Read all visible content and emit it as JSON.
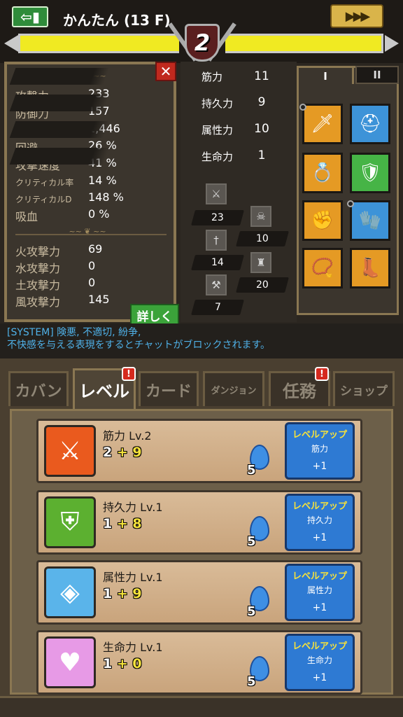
{
  "header": {
    "exit_icon": "exit-door-icon",
    "title": "かんたん (13 F)",
    "speed_label": "▶▶▶",
    "level": "2"
  },
  "stats": {
    "close_label": "✕",
    "rows": [
      {
        "label": "攻撃力",
        "value": "233"
      },
      {
        "label": "防御力",
        "value": "157"
      },
      {
        "label": "体力",
        "value": "1,446"
      },
      {
        "label": "回避",
        "value": "26 %"
      },
      {
        "label": "攻撃速度",
        "value": "41 %"
      },
      {
        "label": "クリティカル率",
        "value": "14 %"
      },
      {
        "label": "クリティカルD",
        "value": "148 %"
      },
      {
        "label": "吸血",
        "value": "0 %"
      }
    ],
    "element_rows": [
      {
        "label": "火攻撃力",
        "value": "69"
      },
      {
        "label": "水攻撃力",
        "value": "0"
      },
      {
        "label": "土攻撃力",
        "value": "0"
      },
      {
        "label": "風攻撃力",
        "value": "145"
      }
    ],
    "detail_label": "詳しく"
  },
  "attributes": {
    "rows": [
      {
        "label": "筋力",
        "value": "11"
      },
      {
        "label": "持久力",
        "value": "9"
      },
      {
        "label": "属性力",
        "value": "10"
      },
      {
        "label": "生命力",
        "value": "1"
      }
    ],
    "minis": [
      {
        "icon": "sword-icon",
        "value": "23"
      },
      {
        "icon": "skull-icon",
        "value": "10"
      },
      {
        "icon": "dagger-icon",
        "value": "14"
      },
      {
        "icon": "castle-icon",
        "value": "20"
      },
      {
        "icon": "axe-icon",
        "value": "7"
      }
    ]
  },
  "equipment": {
    "tabs": [
      "I",
      "II"
    ],
    "slots": [
      {
        "name": "sword",
        "icon": "🗡"
      },
      {
        "name": "helmet",
        "icon": "⛑"
      },
      {
        "name": "ring",
        "icon": "💍"
      },
      {
        "name": "armor",
        "icon": "🛡"
      },
      {
        "name": "gauntlet",
        "icon": "✊"
      },
      {
        "name": "glove",
        "icon": "🧤"
      },
      {
        "name": "necklace",
        "icon": "📿"
      },
      {
        "name": "boots",
        "icon": "👢"
      }
    ]
  },
  "chat": {
    "line1": "[SYSTEM] 険悪, 不適切, 紛争,",
    "line2": "不快感を与える表現をするとチャットがブロックされます。"
  },
  "tabs": [
    {
      "label": "カバン"
    },
    {
      "label": "レベル"
    },
    {
      "label": "カード"
    },
    {
      "label": "ダンジョン"
    },
    {
      "label": "任務"
    },
    {
      "label": "ショップ"
    }
  ],
  "badges": {
    "level": "!",
    "quest": "!"
  },
  "cards": [
    {
      "title": "筋力 Lv.2",
      "base": "2",
      "plus": "+",
      "bonus": "9",
      "cost": "5",
      "btn_title": "レベルアップ",
      "btn_stat": "筋力",
      "btn_amount": "+1"
    },
    {
      "title": "持久力 Lv.1",
      "base": "1",
      "plus": "+",
      "bonus": "8",
      "cost": "5",
      "btn_title": "レベルアップ",
      "btn_stat": "持久力",
      "btn_amount": "+1"
    },
    {
      "title": "属性力 Lv.1",
      "base": "1",
      "plus": "+",
      "bonus": "9",
      "cost": "5",
      "btn_title": "レベルアップ",
      "btn_stat": "属性力",
      "btn_amount": "+1"
    },
    {
      "title": "生命力 Lv.1",
      "base": "1",
      "plus": "+",
      "bonus": "0",
      "cost": "5",
      "btn_title": "レベルアップ",
      "btn_stat": "生命力",
      "btn_amount": "+1"
    }
  ],
  "colors": {
    "hp": "#f0ea22",
    "accent_blue": "#2e7ad3",
    "panel_border": "#8a7752"
  }
}
